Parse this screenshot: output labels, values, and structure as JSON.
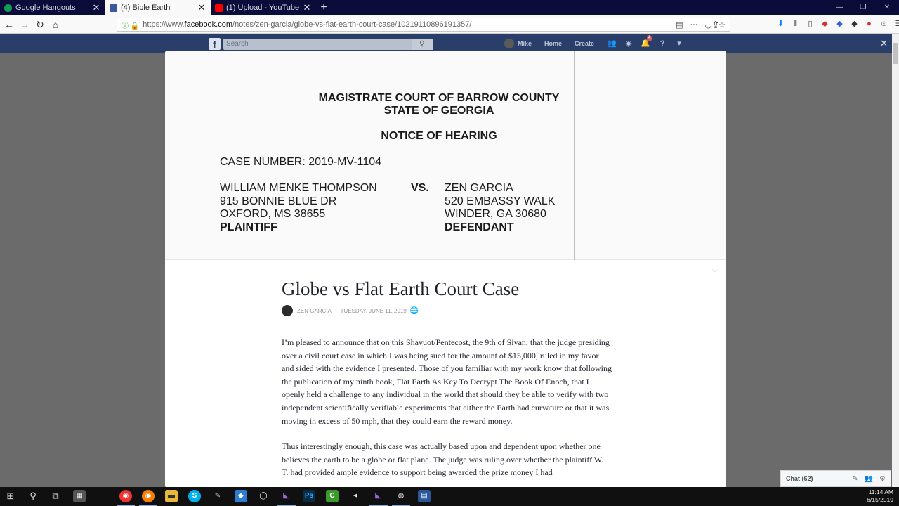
{
  "browser": {
    "tabs": [
      {
        "title": "Google Hangouts",
        "favicon_color": "#0f9d58",
        "active": false
      },
      {
        "title": "(4) Bible Earth",
        "favicon_color": "#3b5998",
        "active": true
      },
      {
        "title": "(1) Upload - YouTube",
        "favicon_color": "#ff0000",
        "active": false
      }
    ],
    "url_prefix": "https://www.",
    "url_domain": "facebook.com",
    "url_path": "/notes/zen-garcia/globe-vs-flat-earth-court-case/10219110896191357/"
  },
  "facebook": {
    "search_placeholder": "Search",
    "user_name": "Mike",
    "home_label": "Home",
    "create_label": "Create",
    "notifications_count": "4"
  },
  "note": {
    "document": {
      "court_line1": "MAGISTRATE COURT OF BARROW COUNTY",
      "court_line2": "STATE OF GEORGIA",
      "notice": "NOTICE OF HEARING",
      "case_number": "CASE NUMBER: 2019-MV-1104",
      "plaintiff": {
        "name": "WILLIAM MENKE THOMPSON",
        "address1": "915 BONNIE BLUE DR",
        "address2": "OXFORD, MS 38655",
        "role": "PLAINTIFF"
      },
      "vs": "VS.",
      "defendant": {
        "name": "ZEN GARCIA",
        "address1": "520 EMBASSY WALK",
        "address2": "WINDER, GA 30680",
        "role": "DEFENDANT"
      }
    },
    "title": "Globe vs Flat Earth Court Case",
    "author": "ZEN GARCIA",
    "date": "TUESDAY, JUNE 11, 2019",
    "paragraphs": [
      "I’m pleased to announce that on this Shavuot/Pentecost, the 9th of Sivan, that the judge presiding over a civil court case in which I was being sued for the amount of $15,000, ruled in my favor and sided with the evidence I presented. Those of you familiar with my work know that following the publication of my ninth book, Flat Earth As Key To Decrypt The Book Of Enoch, that I openly held a challenge to any individual in the world that should they be able to verify with two independent scientifically verifiable experiments that either the Earth had curvature or that it was moving in excess of 50 mph, that they could earn the reward money.",
      "Thus interestingly enough, this case was actually based upon and dependent upon whether one believes the earth to be a globe or flat plane. The judge was ruling over whether the plaintiff W. T. had provided ample evidence to support being awarded the prize money I had"
    ]
  },
  "chat": {
    "label": "Chat (62)"
  },
  "taskbar": {
    "time": "11:14 AM",
    "date": "6/15/2019"
  }
}
